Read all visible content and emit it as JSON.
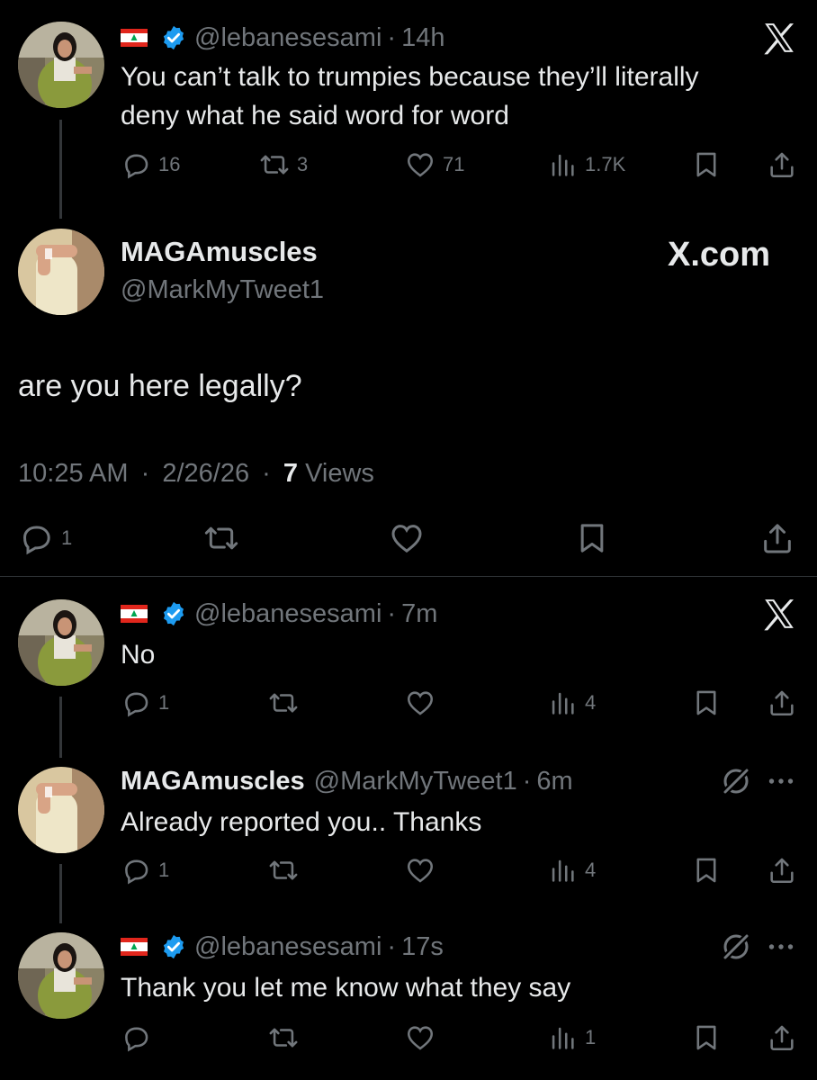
{
  "tweet1": {
    "handle": "@lebanesesami",
    "time": "14h",
    "text_line1": "You can’t talk to trumpies because they’ll literally",
    "text_line2": "deny what he said word for word",
    "replies": "16",
    "retweets": "3",
    "likes": "71",
    "views": "1.7K"
  },
  "main_tweet": {
    "name": "MAGAmuscles",
    "handle": "@MarkMyTweet1",
    "watermark": "X.com",
    "text": "are you here legally?",
    "time": "10:25 AM",
    "date": "2/26/26",
    "views_count": "7",
    "views_label": "Views",
    "replies": "1"
  },
  "reply1": {
    "handle": "@lebanesesami",
    "time": "7m",
    "text": "No",
    "replies": "1",
    "views": "4"
  },
  "reply2": {
    "name": "MAGAmuscles",
    "handle": "@MarkMyTweet1",
    "time": "6m",
    "text": "Already reported you.. Thanks",
    "replies": "1",
    "views": "4"
  },
  "reply3": {
    "handle": "@lebanesesami",
    "time": "17s",
    "text": "Thank you let me know what they say",
    "views": "1"
  },
  "separator": "·",
  "colors": {
    "background": "#000000",
    "text": "#e7e9ea",
    "muted": "#71767b",
    "verified": "#1d9bf0",
    "divider": "#2f3336"
  }
}
